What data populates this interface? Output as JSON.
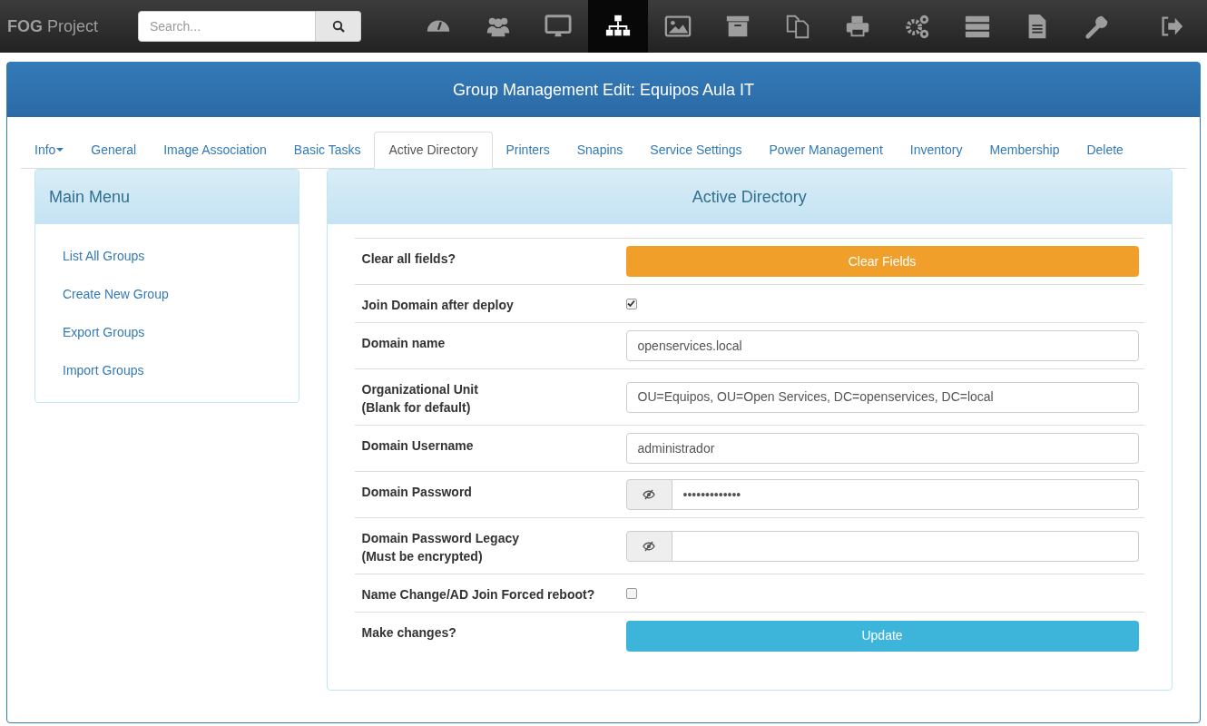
{
  "brand": {
    "bold": "FOG",
    "rest": "Project"
  },
  "search": {
    "placeholder": "Search..."
  },
  "nav_icons": [
    {
      "selected": false
    },
    {
      "selected": false
    },
    {
      "selected": false
    },
    {
      "selected": true
    },
    {
      "selected": false
    },
    {
      "selected": false
    },
    {
      "selected": false
    },
    {
      "selected": false
    },
    {
      "selected": false
    },
    {
      "selected": false
    },
    {
      "selected": false
    },
    {
      "selected": false
    },
    {
      "selected": false
    }
  ],
  "page_title": "Group Management Edit: Equipos Aula IT",
  "tabs": [
    {
      "label": "Info",
      "dropdown": true,
      "selected": false
    },
    {
      "label": "General",
      "dropdown": false,
      "selected": false
    },
    {
      "label": "Image Association",
      "dropdown": false,
      "selected": false
    },
    {
      "label": "Basic Tasks",
      "dropdown": false,
      "selected": false
    },
    {
      "label": "Active Directory",
      "dropdown": false,
      "selected": true
    },
    {
      "label": "Printers",
      "dropdown": false,
      "selected": false
    },
    {
      "label": "Snapins",
      "dropdown": false,
      "selected": false
    },
    {
      "label": "Service Settings",
      "dropdown": false,
      "selected": false
    },
    {
      "label": "Power Management",
      "dropdown": false,
      "selected": false
    },
    {
      "label": "Inventory",
      "dropdown": false,
      "selected": false
    },
    {
      "label": "Membership",
      "dropdown": false,
      "selected": false
    },
    {
      "label": "Delete",
      "dropdown": false,
      "selected": false
    }
  ],
  "main_menu": {
    "title": "Main Menu",
    "items": [
      "List All Groups",
      "Create New Group",
      "Export Groups",
      "Import Groups"
    ]
  },
  "panel": {
    "title": "Active Directory",
    "rows": [
      {
        "kind": "button",
        "label": "Clear all fields?",
        "button": "Clear Fields",
        "color": "#f0a02a"
      },
      {
        "kind": "checkbox",
        "label": "Join Domain after deploy",
        "checked": true
      },
      {
        "kind": "text",
        "label": "Domain name",
        "value": "openservices.local"
      },
      {
        "kind": "text",
        "label": "Organizational Unit",
        "sublabel": "(Blank for default)",
        "value": "OU=Equipos, OU=Open Services, DC=openservices, DC=local"
      },
      {
        "kind": "text",
        "label": "Domain Username",
        "value": "administrador"
      },
      {
        "kind": "password",
        "label": "Domain Password",
        "value": "•••••••••••••"
      },
      {
        "kind": "password",
        "label": "Domain Password Legacy",
        "sublabel": "(Must be encrypted)",
        "value": ""
      },
      {
        "kind": "checkbox",
        "label": "Name Change/AD Join Forced reboot?",
        "checked": false
      },
      {
        "kind": "button",
        "label": "Make changes?",
        "button": "Update",
        "color": "#3db5da"
      }
    ]
  }
}
